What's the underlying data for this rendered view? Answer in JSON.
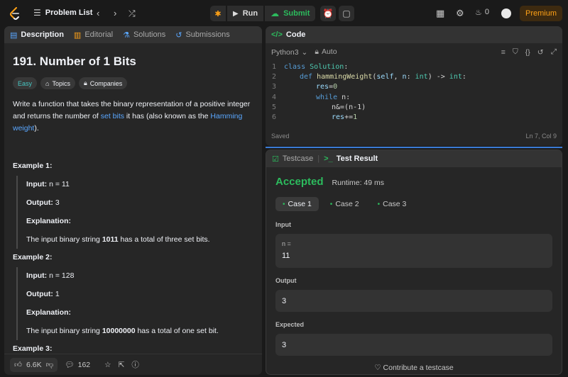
{
  "header": {
    "problem_list": "Problem List",
    "run_label": "Run",
    "submit_label": "Submit",
    "streak_count": "0",
    "premium_label": "Premium"
  },
  "left": {
    "tabs": [
      {
        "label": "Description"
      },
      {
        "label": "Editorial"
      },
      {
        "label": "Solutions"
      },
      {
        "label": "Submissions"
      }
    ],
    "title": "191. Number of 1 Bits",
    "tags": {
      "difficulty": "Easy",
      "topics": "Topics",
      "companies": "Companies"
    },
    "description": {
      "part1": "Write a function that takes the binary representation of a positive integer and returns the number of ",
      "link1": "set bits",
      "part2": " it has (also known as the ",
      "link2": "Hamming weight",
      "part3": ")."
    },
    "examples": [
      {
        "heading": "Example 1:",
        "input_label": "Input:",
        "input_value": "n  =  11",
        "output_label": "Output:",
        "output_value": "3",
        "explanation_label": "Explanation:",
        "explanation_pre": "The input binary string ",
        "explanation_bold": "1011",
        "explanation_post": " has a total of three set bits."
      },
      {
        "heading": "Example 2:",
        "input_label": "Input:",
        "input_value": "n  =  128",
        "output_label": "Output:",
        "output_value": "1",
        "explanation_label": "Explanation:",
        "explanation_pre": "The input binary string ",
        "explanation_bold": "10000000",
        "explanation_post": " has a total of one set bit."
      },
      {
        "heading": "Example 3:"
      }
    ],
    "footer": {
      "likes": "6.6K",
      "comments": "162"
    }
  },
  "code": {
    "tab_label": "Code",
    "language": "Python3",
    "mode": "Auto",
    "lines": [
      {
        "n": "1"
      },
      {
        "n": "2"
      },
      {
        "n": "3"
      },
      {
        "n": "4"
      },
      {
        "n": "5"
      },
      {
        "n": "6"
      }
    ],
    "tokens": {
      "l1a": "class",
      "l1b": "Solution",
      "l1c": ":",
      "l2a": "def",
      "l2b": "hammingWeight",
      "l2c": "(",
      "l2d": "self",
      "l2e": ", ",
      "l2f": "n",
      "l2g": ": ",
      "l2h": "int",
      "l2i": ") -> ",
      "l2j": "int",
      "l2k": ":",
      "l3a": "res",
      "l3b": "=",
      "l3c": "0",
      "l4a": "while",
      "l4b": " n:",
      "l5a": "n&=(n-1)",
      "l6a": "res",
      "l6b": "+=",
      "l6c": "1"
    },
    "status": "Saved",
    "position": "Ln 7, Col 9"
  },
  "result": {
    "tabs": [
      {
        "label": "Testcase"
      },
      {
        "label": "Test Result"
      }
    ],
    "status": "Accepted",
    "runtime": "Runtime: 49 ms",
    "cases": [
      {
        "label": "Case 1"
      },
      {
        "label": "Case 2"
      },
      {
        "label": "Case 3"
      }
    ],
    "input_label": "Input",
    "input_var": "n =",
    "input_value": "11",
    "output_label": "Output",
    "output_value": "3",
    "expected_label": "Expected",
    "expected_value": "3",
    "contribute": "Contribute a testcase"
  }
}
